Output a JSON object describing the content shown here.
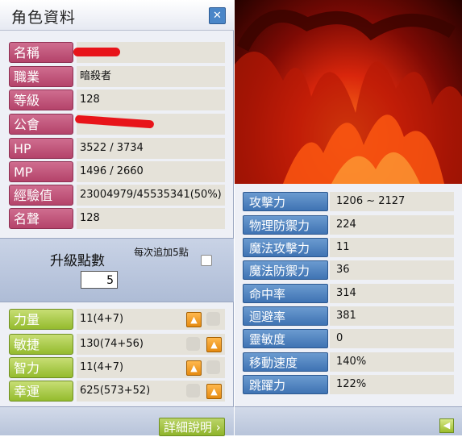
{
  "window": {
    "title": "角色資料",
    "close_icon": "close-icon"
  },
  "info_rows": [
    {
      "label": "名稱",
      "value": ""
    },
    {
      "label": "職業",
      "value": "暗殺者"
    },
    {
      "label": "等級",
      "value": "128"
    },
    {
      "label": "公會",
      "value": ""
    },
    {
      "label": "HP",
      "value": "3522 / 3734"
    },
    {
      "label": "MP",
      "value": "1496 / 2660"
    },
    {
      "label": "經驗值",
      "value": "23004979/45535341(50%)"
    },
    {
      "label": "名聲",
      "value": "128"
    }
  ],
  "ability_points": {
    "label": "升級點數",
    "value": "5",
    "auto_label": "每次追加5點"
  },
  "stats": [
    {
      "label": "力量",
      "value": "11(4+7)"
    },
    {
      "label": "敏捷",
      "value": "130(74+56)"
    },
    {
      "label": "智力",
      "value": "11(4+7)"
    },
    {
      "label": "幸運",
      "value": "625(573+52)"
    }
  ],
  "detail_button": {
    "label": "詳細說明"
  },
  "combat_stats": [
    {
      "label": "攻擊力",
      "value": "1206 ~ 2127"
    },
    {
      "label": "物理防禦力",
      "value": "224"
    },
    {
      "label": "魔法攻擊力",
      "value": "11"
    },
    {
      "label": "魔法防禦力",
      "value": "36"
    },
    {
      "label": "命中率",
      "value": "314"
    },
    {
      "label": "迴避率",
      "value": "381"
    },
    {
      "label": "靈敏度",
      "value": "0"
    },
    {
      "label": "移動速度",
      "value": "140%"
    },
    {
      "label": "跳躍力",
      "value": "122%"
    }
  ],
  "colors": {
    "pink_label": "#c0527a",
    "green_label": "#9cc23a",
    "blue_label": "#4f83c2",
    "value_bg": "#e5e2d9"
  }
}
